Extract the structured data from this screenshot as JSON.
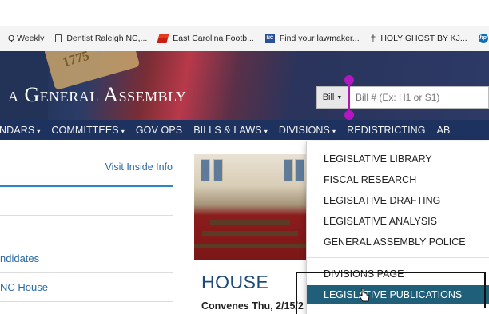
{
  "bookmarks": [
    {
      "label": "Q Weekly",
      "icon": "none"
    },
    {
      "label": "Dentist Raleigh NC,...",
      "icon": "document-icon"
    },
    {
      "label": "East Carolina Footb...",
      "icon": "ecu-logo-icon"
    },
    {
      "label": "Find your lawmaker...",
      "icon": "lawmaker-icon"
    },
    {
      "label": "HOLY GHOST BY KJ...",
      "icon": "cross-icon"
    },
    {
      "label": "",
      "icon": "hp-icon"
    }
  ],
  "hero": {
    "title": "a General Assembly",
    "flag_text": "1775"
  },
  "search": {
    "scope_label": "Bill",
    "placeholder": "Bill # (Ex: H1 or S1)"
  },
  "nav": {
    "items": [
      {
        "label": "NDARS",
        "caret": "▾"
      },
      {
        "label": "COMMITTEES",
        "caret": "▾"
      },
      {
        "label": "GOV OPS",
        "caret": ""
      },
      {
        "label": "BILLS & LAWS",
        "caret": "▾"
      },
      {
        "label": "DIVISIONS",
        "caret": "▾"
      },
      {
        "label": "REDISTRICTING",
        "caret": ""
      },
      {
        "label": "AB",
        "caret": ""
      }
    ]
  },
  "left_panel": {
    "visit_link": "Visit Inside Info",
    "rows": [
      "",
      "",
      "ndidates",
      "NC House"
    ]
  },
  "main": {
    "house_heading": "HOUSE",
    "convenes_text": "Convenes Thu, 2/15/2"
  },
  "dropdown": {
    "items": [
      "LEGISLATIVE LIBRARY",
      "FISCAL RESEARCH",
      "LEGISLATIVE DRAFTING",
      "LEGISLATIVE ANALYSIS",
      "GENERAL ASSEMBLY POLICE"
    ],
    "divisions_page": "DIVISIONS PAGE",
    "highlighted": "LEGISLATIVE PUBLICATIONS"
  },
  "colors": {
    "nav_bg": "#1e3260",
    "highlight_bg": "#1f5f7a",
    "link": "#2a6aa3",
    "annotation": "#b516c3"
  }
}
